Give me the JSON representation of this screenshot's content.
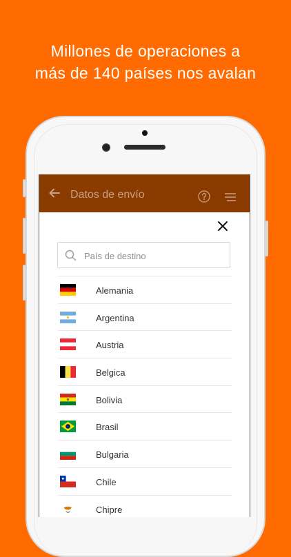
{
  "headline": [
    "Millones de operaciones a",
    "más de 140 países nos avalan"
  ],
  "appbar": {
    "title": "Datos de envío",
    "back_icon": "arrow-left-icon",
    "help_icon": "question-circle-icon",
    "menu_icon": "menu-icon"
  },
  "search": {
    "placeholder": "País de destino",
    "value": ""
  },
  "countries": [
    {
      "name": "Alemania",
      "flag": "de"
    },
    {
      "name": "Argentina",
      "flag": "ar"
    },
    {
      "name": "Austria",
      "flag": "at"
    },
    {
      "name": "Belgica",
      "flag": "be"
    },
    {
      "name": "Bolivia",
      "flag": "bo"
    },
    {
      "name": "Brasil",
      "flag": "br"
    },
    {
      "name": "Bulgaria",
      "flag": "bg"
    },
    {
      "name": "Chile",
      "flag": "cl"
    },
    {
      "name": "Chipre",
      "flag": "cy"
    }
  ],
  "colors": {
    "background": "#FF6B00",
    "appbar": "#8A3B00"
  }
}
